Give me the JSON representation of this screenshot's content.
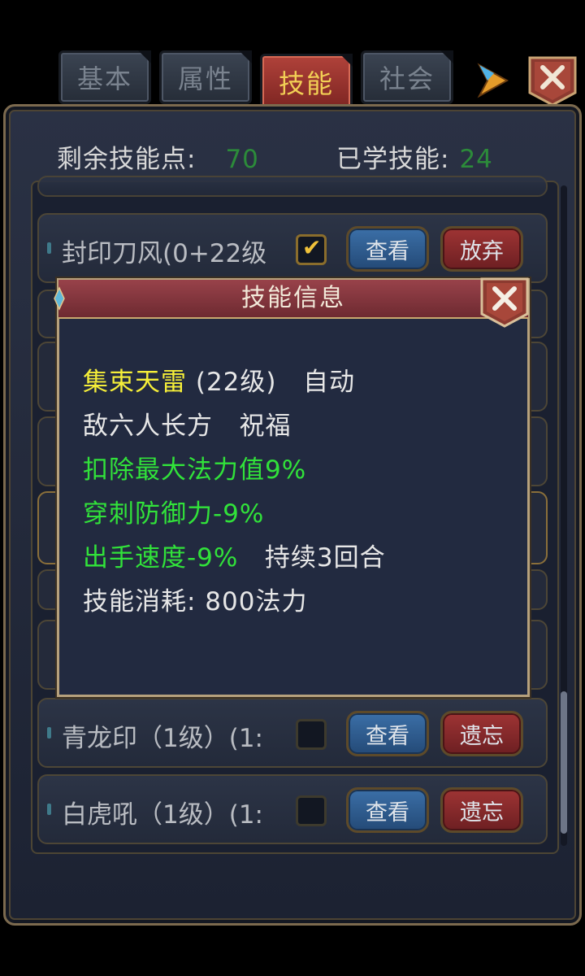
{
  "tabs": [
    {
      "label": "基本",
      "active": false
    },
    {
      "label": "属性",
      "active": false
    },
    {
      "label": "技能",
      "active": true
    },
    {
      "label": "社会",
      "active": false
    }
  ],
  "stats": {
    "points_label": "剩余技能点:",
    "points_value": "70",
    "learned_label": "已学技能:",
    "learned_value": "24"
  },
  "skills": [
    {
      "name": "封印刀风(0+22级",
      "checked": true,
      "view_label": "查看",
      "action_label": "放弃"
    },
    {
      "name": "青龙印（1级）(1:",
      "checked": false,
      "view_label": "查看",
      "action_label": "遗忘"
    },
    {
      "name": "白虎吼（1级）(1:",
      "checked": false,
      "view_label": "查看",
      "action_label": "遗忘"
    }
  ],
  "dialog": {
    "title": "技能信息",
    "skill_name": "集束天雷",
    "skill_level": " (22级)",
    "skill_mode": "   自动",
    "target_line": "敌六人长方   祝福",
    "effect_1": "扣除最大法力值9%",
    "effect_2": "穿刺防御力-9%",
    "effect_3": "出手速度-9%",
    "duration": "   持续3回合",
    "cost": "技能消耗: 800法力"
  },
  "colors": {
    "accent_yellow": "#f5ee39",
    "effect_green": "#31e23a",
    "stat_green": "#2c8b3a",
    "active_tab": "#b0423a"
  },
  "icons": [
    "next-arrow-icon",
    "close-icon",
    "checkmark-icon"
  ]
}
